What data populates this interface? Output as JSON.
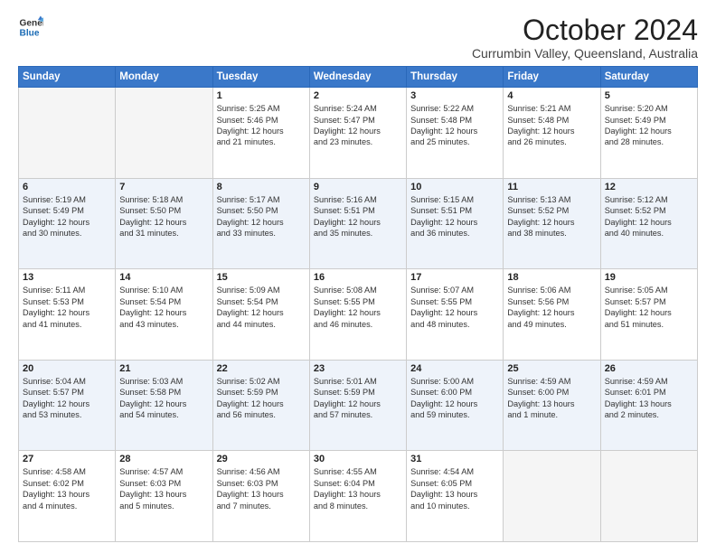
{
  "logo": {
    "line1": "General",
    "line2": "Blue"
  },
  "header": {
    "month": "October 2024",
    "location": "Currumbin Valley, Queensland, Australia"
  },
  "weekdays": [
    "Sunday",
    "Monday",
    "Tuesday",
    "Wednesday",
    "Thursday",
    "Friday",
    "Saturday"
  ],
  "weeks": [
    [
      {
        "day": "",
        "empty": true,
        "lines": []
      },
      {
        "day": "",
        "empty": true,
        "lines": []
      },
      {
        "day": "1",
        "lines": [
          "Sunrise: 5:25 AM",
          "Sunset: 5:46 PM",
          "Daylight: 12 hours",
          "and 21 minutes."
        ]
      },
      {
        "day": "2",
        "lines": [
          "Sunrise: 5:24 AM",
          "Sunset: 5:47 PM",
          "Daylight: 12 hours",
          "and 23 minutes."
        ]
      },
      {
        "day": "3",
        "lines": [
          "Sunrise: 5:22 AM",
          "Sunset: 5:48 PM",
          "Daylight: 12 hours",
          "and 25 minutes."
        ]
      },
      {
        "day": "4",
        "lines": [
          "Sunrise: 5:21 AM",
          "Sunset: 5:48 PM",
          "Daylight: 12 hours",
          "and 26 minutes."
        ]
      },
      {
        "day": "5",
        "lines": [
          "Sunrise: 5:20 AM",
          "Sunset: 5:49 PM",
          "Daylight: 12 hours",
          "and 28 minutes."
        ]
      }
    ],
    [
      {
        "day": "6",
        "lines": [
          "Sunrise: 5:19 AM",
          "Sunset: 5:49 PM",
          "Daylight: 12 hours",
          "and 30 minutes."
        ]
      },
      {
        "day": "7",
        "lines": [
          "Sunrise: 5:18 AM",
          "Sunset: 5:50 PM",
          "Daylight: 12 hours",
          "and 31 minutes."
        ]
      },
      {
        "day": "8",
        "lines": [
          "Sunrise: 5:17 AM",
          "Sunset: 5:50 PM",
          "Daylight: 12 hours",
          "and 33 minutes."
        ]
      },
      {
        "day": "9",
        "lines": [
          "Sunrise: 5:16 AM",
          "Sunset: 5:51 PM",
          "Daylight: 12 hours",
          "and 35 minutes."
        ]
      },
      {
        "day": "10",
        "lines": [
          "Sunrise: 5:15 AM",
          "Sunset: 5:51 PM",
          "Daylight: 12 hours",
          "and 36 minutes."
        ]
      },
      {
        "day": "11",
        "lines": [
          "Sunrise: 5:13 AM",
          "Sunset: 5:52 PM",
          "Daylight: 12 hours",
          "and 38 minutes."
        ]
      },
      {
        "day": "12",
        "lines": [
          "Sunrise: 5:12 AM",
          "Sunset: 5:52 PM",
          "Daylight: 12 hours",
          "and 40 minutes."
        ]
      }
    ],
    [
      {
        "day": "13",
        "lines": [
          "Sunrise: 5:11 AM",
          "Sunset: 5:53 PM",
          "Daylight: 12 hours",
          "and 41 minutes."
        ]
      },
      {
        "day": "14",
        "lines": [
          "Sunrise: 5:10 AM",
          "Sunset: 5:54 PM",
          "Daylight: 12 hours",
          "and 43 minutes."
        ]
      },
      {
        "day": "15",
        "lines": [
          "Sunrise: 5:09 AM",
          "Sunset: 5:54 PM",
          "Daylight: 12 hours",
          "and 44 minutes."
        ]
      },
      {
        "day": "16",
        "lines": [
          "Sunrise: 5:08 AM",
          "Sunset: 5:55 PM",
          "Daylight: 12 hours",
          "and 46 minutes."
        ]
      },
      {
        "day": "17",
        "lines": [
          "Sunrise: 5:07 AM",
          "Sunset: 5:55 PM",
          "Daylight: 12 hours",
          "and 48 minutes."
        ]
      },
      {
        "day": "18",
        "lines": [
          "Sunrise: 5:06 AM",
          "Sunset: 5:56 PM",
          "Daylight: 12 hours",
          "and 49 minutes."
        ]
      },
      {
        "day": "19",
        "lines": [
          "Sunrise: 5:05 AM",
          "Sunset: 5:57 PM",
          "Daylight: 12 hours",
          "and 51 minutes."
        ]
      }
    ],
    [
      {
        "day": "20",
        "lines": [
          "Sunrise: 5:04 AM",
          "Sunset: 5:57 PM",
          "Daylight: 12 hours",
          "and 53 minutes."
        ]
      },
      {
        "day": "21",
        "lines": [
          "Sunrise: 5:03 AM",
          "Sunset: 5:58 PM",
          "Daylight: 12 hours",
          "and 54 minutes."
        ]
      },
      {
        "day": "22",
        "lines": [
          "Sunrise: 5:02 AM",
          "Sunset: 5:59 PM",
          "Daylight: 12 hours",
          "and 56 minutes."
        ]
      },
      {
        "day": "23",
        "lines": [
          "Sunrise: 5:01 AM",
          "Sunset: 5:59 PM",
          "Daylight: 12 hours",
          "and 57 minutes."
        ]
      },
      {
        "day": "24",
        "lines": [
          "Sunrise: 5:00 AM",
          "Sunset: 6:00 PM",
          "Daylight: 12 hours",
          "and 59 minutes."
        ]
      },
      {
        "day": "25",
        "lines": [
          "Sunrise: 4:59 AM",
          "Sunset: 6:00 PM",
          "Daylight: 13 hours",
          "and 1 minute."
        ]
      },
      {
        "day": "26",
        "lines": [
          "Sunrise: 4:59 AM",
          "Sunset: 6:01 PM",
          "Daylight: 13 hours",
          "and 2 minutes."
        ]
      }
    ],
    [
      {
        "day": "27",
        "lines": [
          "Sunrise: 4:58 AM",
          "Sunset: 6:02 PM",
          "Daylight: 13 hours",
          "and 4 minutes."
        ]
      },
      {
        "day": "28",
        "lines": [
          "Sunrise: 4:57 AM",
          "Sunset: 6:03 PM",
          "Daylight: 13 hours",
          "and 5 minutes."
        ]
      },
      {
        "day": "29",
        "lines": [
          "Sunrise: 4:56 AM",
          "Sunset: 6:03 PM",
          "Daylight: 13 hours",
          "and 7 minutes."
        ]
      },
      {
        "day": "30",
        "lines": [
          "Sunrise: 4:55 AM",
          "Sunset: 6:04 PM",
          "Daylight: 13 hours",
          "and 8 minutes."
        ]
      },
      {
        "day": "31",
        "lines": [
          "Sunrise: 4:54 AM",
          "Sunset: 6:05 PM",
          "Daylight: 13 hours",
          "and 10 minutes."
        ]
      },
      {
        "day": "",
        "empty": true,
        "lines": []
      },
      {
        "day": "",
        "empty": true,
        "lines": []
      }
    ]
  ]
}
